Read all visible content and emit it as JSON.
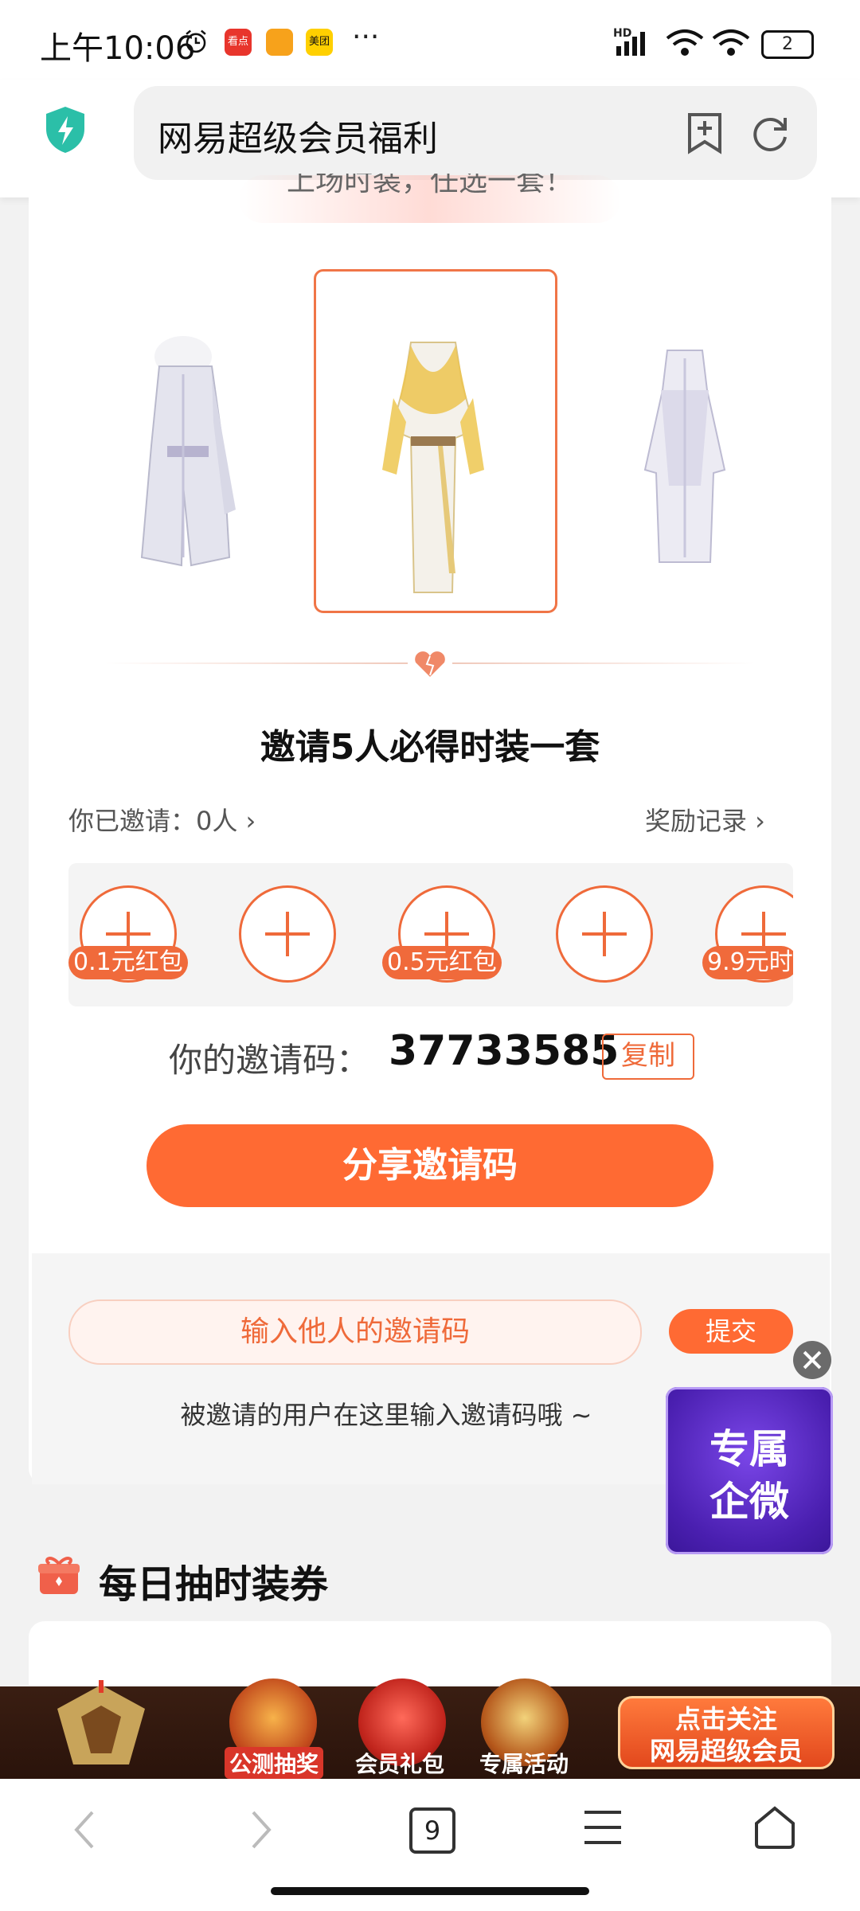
{
  "status_bar": {
    "time": "上午10:06",
    "app_icon_1": "看点",
    "app_icon_3": "美团",
    "more": "···",
    "network": "HD",
    "battery": "2"
  },
  "address_bar": {
    "page_title": "网易超级会员福利"
  },
  "banner_text": "上场时装，任选一套！",
  "invite": {
    "title": "邀请5人必得时装一套",
    "invited_count": "你已邀请：0人 ›",
    "reward_record": "奖励记录 ›",
    "rewards": [
      "0.1元红包",
      "",
      "0.5元红包",
      "",
      "9.9元时"
    ]
  },
  "code": {
    "label": "你的邀请码：",
    "value": "37733585",
    "copy_label": "复制",
    "share_label": "分享邀请码"
  },
  "enter_code": {
    "placeholder": "输入他人的邀请码",
    "submit_label": "提交",
    "hint": "被邀请的用户在这里输入邀请码哦 ~"
  },
  "float_promo": {
    "line1": "专属",
    "line2": "企微"
  },
  "daily": {
    "title": "每日抽时装券"
  },
  "promo_bar": {
    "items": [
      "公测抽奖",
      "会员礼包",
      "专属活动"
    ],
    "follow_line1": "点击关注",
    "follow_line2": "网易超级会员"
  },
  "nav": {
    "tab_count": "9"
  },
  "colors": {
    "accent": "#ff6a33",
    "frame": "#f07547",
    "promo_purple": "#4a1fb0"
  }
}
